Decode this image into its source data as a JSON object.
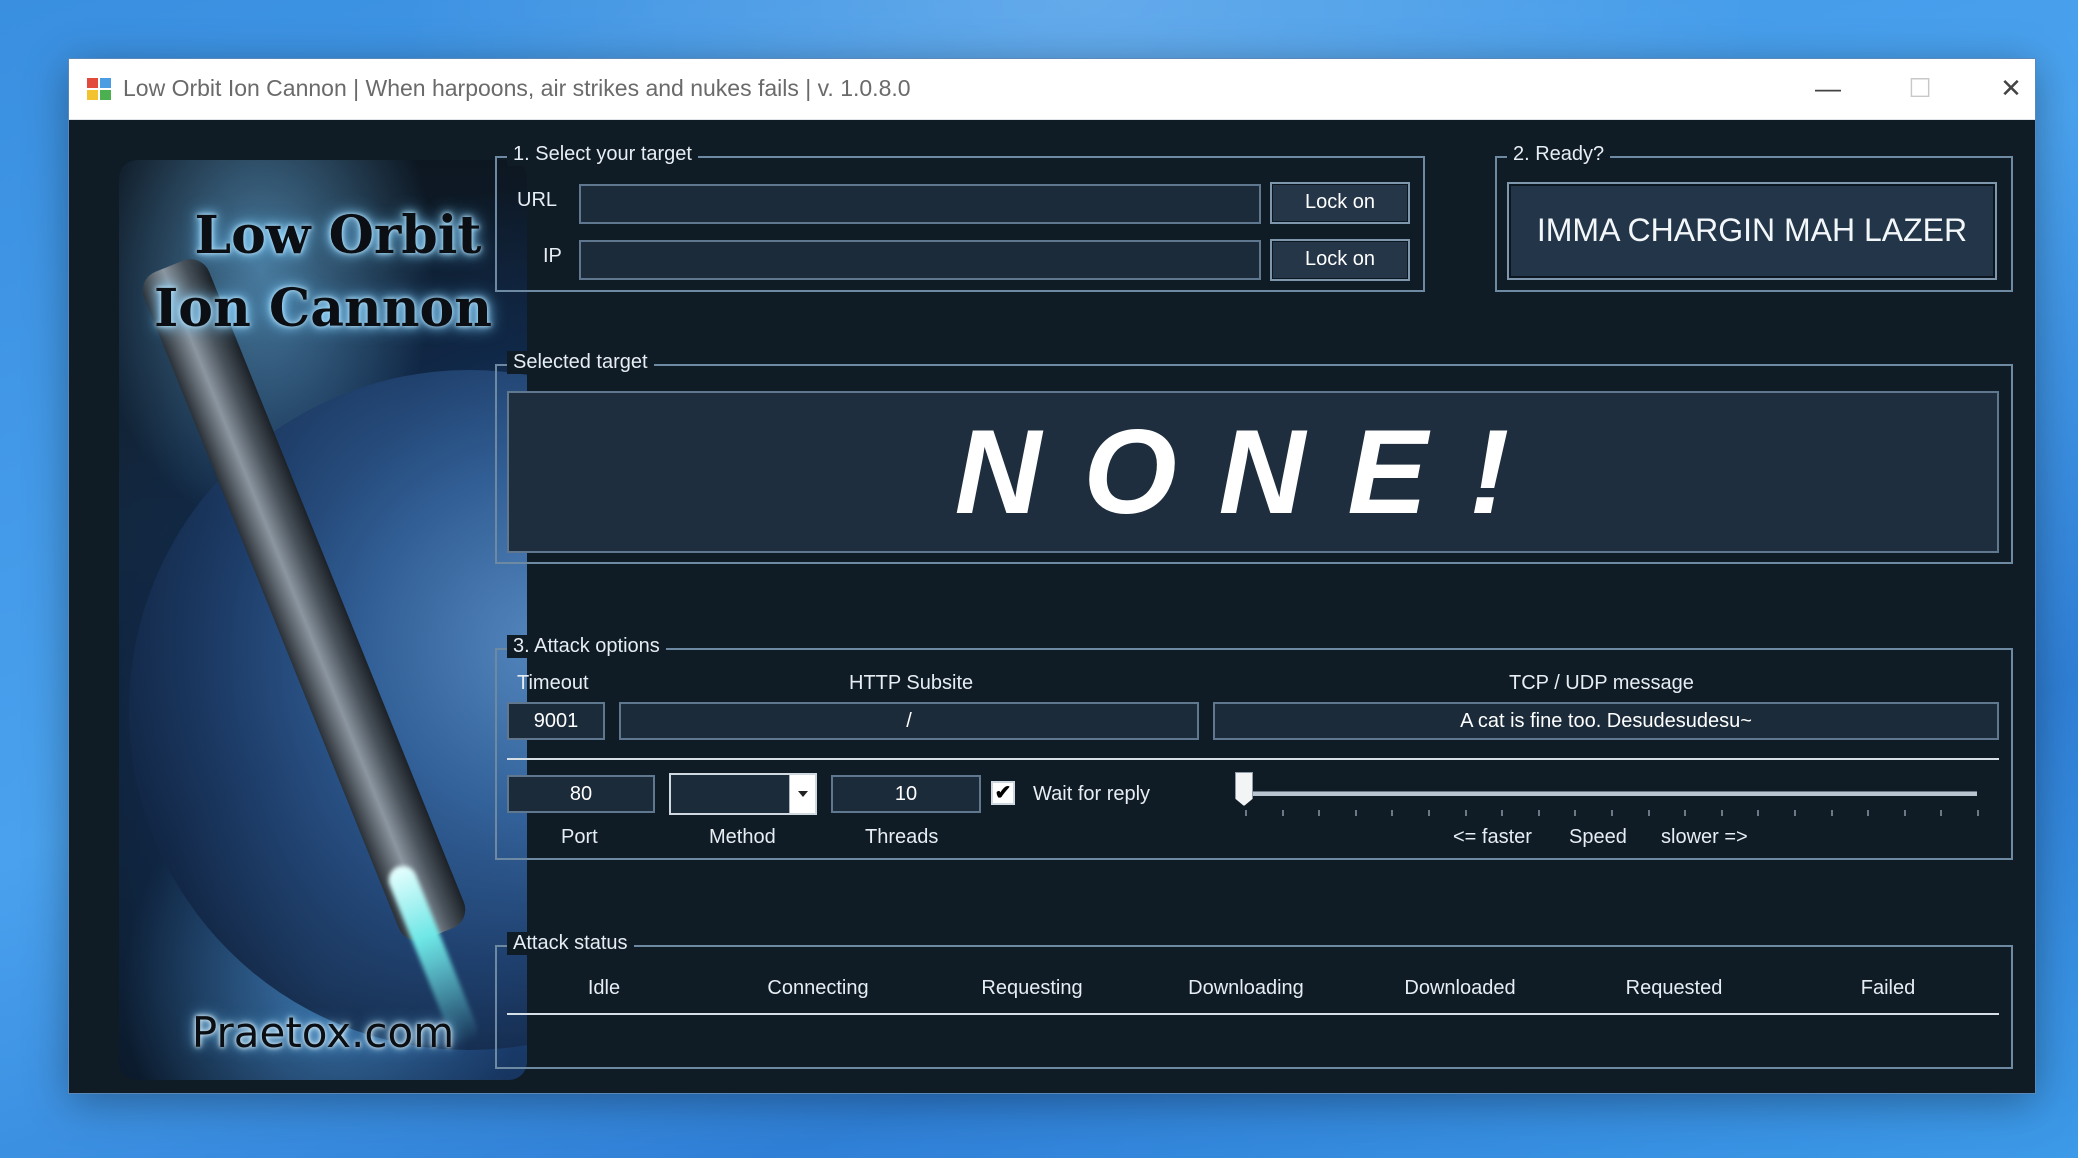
{
  "window": {
    "title": "Low Orbit Ion Cannon | When harpoons, air strikes and nukes fails | v. 1.0.8.0",
    "controls": {
      "minimize": "—",
      "maximize": "☐",
      "close": "✕"
    }
  },
  "banner": {
    "title_line1": "Low Orbit",
    "title_line2": "Ion Cannon",
    "footer": "Praetox.com"
  },
  "target": {
    "group_label": "1. Select your target",
    "url_label": "URL",
    "url_value": "",
    "url_button": "Lock on",
    "ip_label": "IP",
    "ip_value": "",
    "ip_button": "Lock on"
  },
  "ready": {
    "group_label": "2. Ready?",
    "fire_button": "IMMA CHARGIN MAH LAZER"
  },
  "selected": {
    "group_label": "Selected target",
    "value": "NONE!"
  },
  "attack": {
    "group_label": "3. Attack options",
    "timeout_label": "Timeout",
    "timeout_value": "9001",
    "subsite_label": "HTTP Subsite",
    "subsite_value": "/",
    "message_label": "TCP / UDP message",
    "message_value": "A cat is fine too. Desudesudesu~",
    "port_value": "80",
    "port_label": "Port",
    "method_value": "",
    "method_label": "Method",
    "threads_value": "10",
    "threads_label": "Threads",
    "wait_checked": true,
    "wait_check_glyph": "✔",
    "wait_label": "Wait for reply",
    "speed_faster": "<= faster",
    "speed_label": "Speed",
    "speed_slower": "slower =>",
    "speed_level": 0
  },
  "status": {
    "group_label": "Attack status",
    "columns": [
      "Idle",
      "Connecting",
      "Requesting",
      "Downloading",
      "Downloaded",
      "Requested",
      "Failed"
    ]
  },
  "colors": {
    "window_bg": "#0f1b25",
    "border": "#6e8aa3",
    "field_bg": "#1b2b3a",
    "desktop": "#3a8fe0"
  }
}
